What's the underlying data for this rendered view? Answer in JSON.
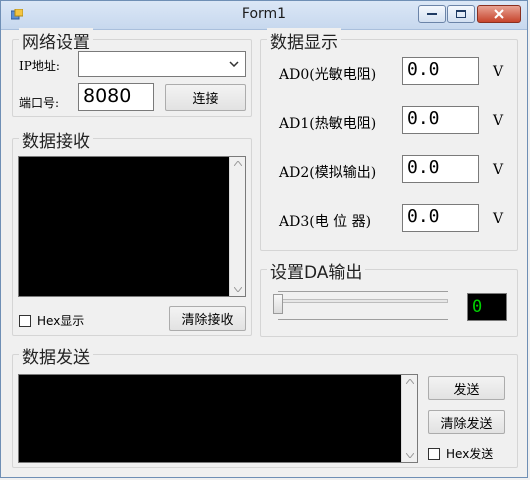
{
  "window": {
    "title": "Form1"
  },
  "network": {
    "group_title": "网络设置",
    "ip_label": "IP地址:",
    "ip_value": "",
    "port_label": "端口号:",
    "port_value": "8080",
    "connect_label": "连接"
  },
  "receive": {
    "group_title": "数据接收",
    "hex_label": "Hex显示",
    "clear_label": "清除接收"
  },
  "display": {
    "group_title": "数据显示",
    "rows": [
      {
        "label": "AD0(光敏电阻)",
        "value": "0.0",
        "unit": "V"
      },
      {
        "label": "AD1(热敏电阻)",
        "value": "0.0",
        "unit": "V"
      },
      {
        "label": "AD2(模拟输出)",
        "value": "0.0",
        "unit": "V"
      },
      {
        "label": "AD3(电 位 器)",
        "value": "0.0",
        "unit": "V"
      }
    ]
  },
  "da": {
    "group_title": "设置DA输出",
    "level": 0,
    "value": "0"
  },
  "send": {
    "group_title": "数据发送",
    "send_label": "发送",
    "clear_label": "清除发送",
    "hex_label": "Hex发送"
  }
}
